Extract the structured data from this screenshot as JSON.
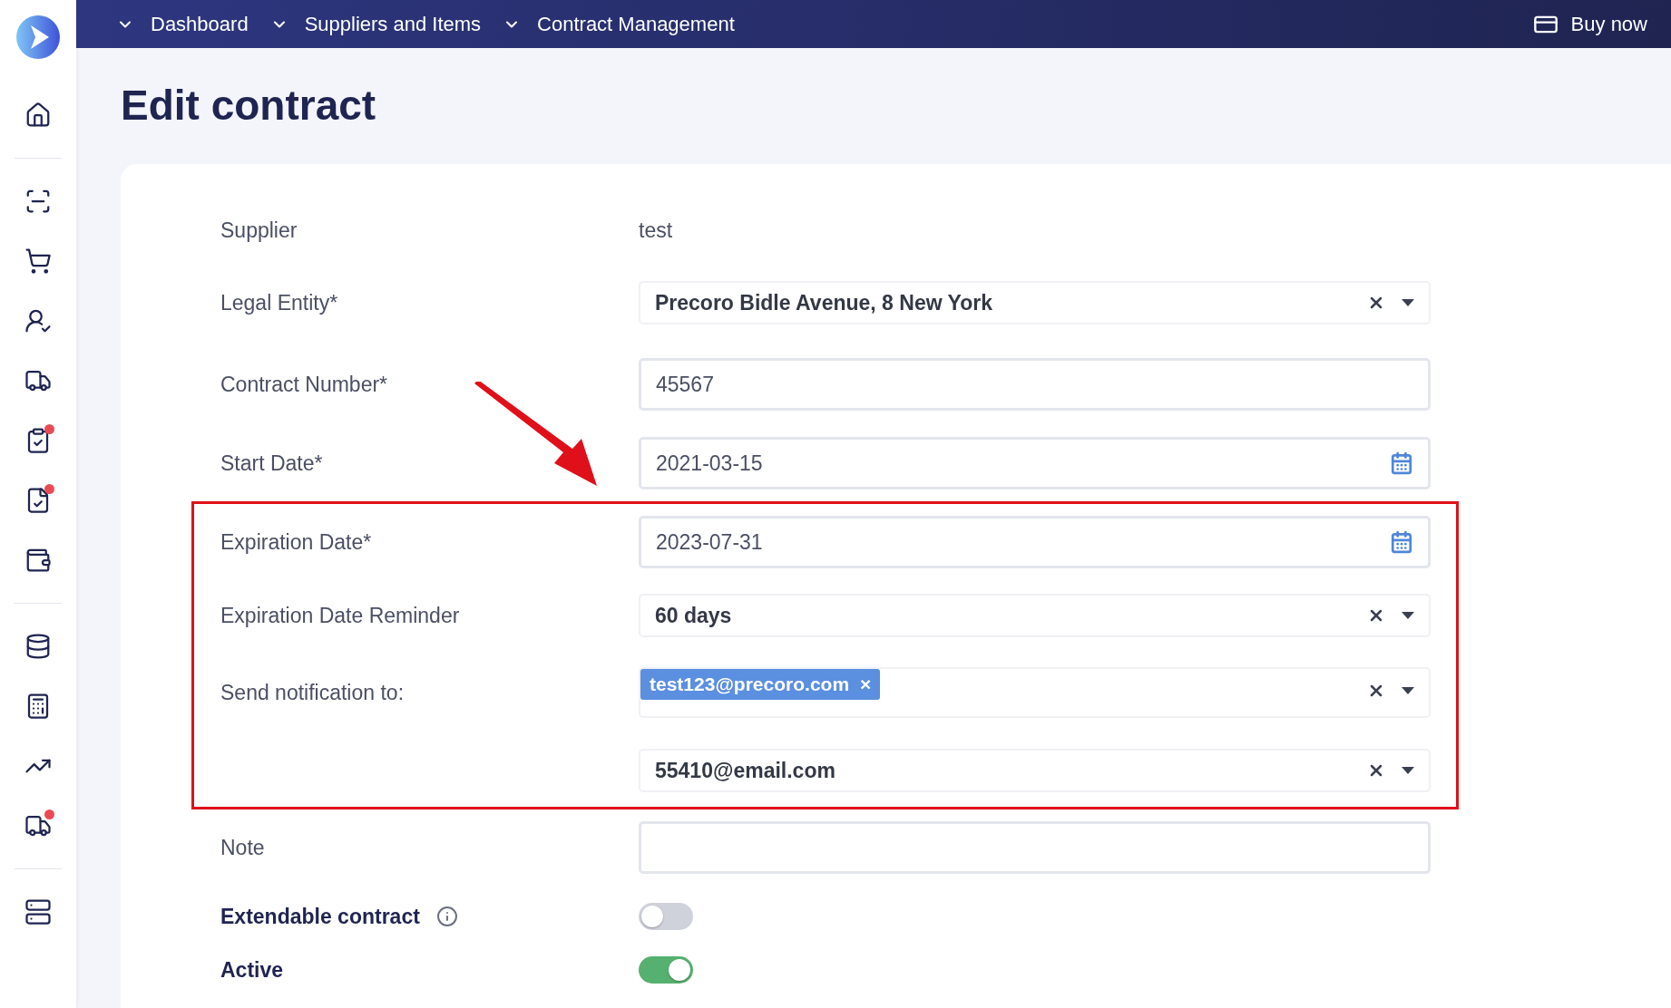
{
  "sidebar": {
    "items": [
      {
        "badge": false
      },
      {
        "badge": false
      },
      {
        "badge": false
      },
      {
        "badge": false
      },
      {
        "badge": false
      },
      {
        "badge": true
      },
      {
        "badge": true
      },
      {
        "badge": false
      },
      {
        "badge": false
      },
      {
        "badge": false
      },
      {
        "badge": false
      },
      {
        "badge": true
      },
      {
        "badge": false
      }
    ]
  },
  "topbar": {
    "menus": [
      {
        "label": "Dashboard"
      },
      {
        "label": "Suppliers and Items"
      },
      {
        "label": "Contract Management"
      }
    ],
    "buy_now": "Buy now"
  },
  "title": "Edit contract",
  "form": {
    "rows": [
      {
        "kind": "text",
        "label": "Supplier",
        "value": "test",
        "highlighted": false
      },
      {
        "kind": "select",
        "label": "Legal Entity*",
        "value": "Precoro Bidle Avenue, 8 New York",
        "highlighted": false
      },
      {
        "kind": "input",
        "label": "Contract Number*",
        "value": "45567",
        "highlighted": false
      },
      {
        "kind": "date",
        "label": "Start Date*",
        "value": "2021-03-15",
        "highlighted": false
      },
      {
        "kind": "date",
        "label": "Expiration Date*",
        "value": "2023-07-31",
        "highlighted": true
      },
      {
        "kind": "select",
        "label": "Expiration Date Reminder",
        "value": "60 days",
        "highlighted": true
      },
      {
        "kind": "tags",
        "label": "Send notification to:",
        "tags": [
          {
            "label": "test123@precoro.com",
            "remove": "×"
          }
        ],
        "highlighted": true
      },
      {
        "kind": "select",
        "value": "55410@email.com",
        "highlighted": true
      },
      {
        "kind": "input",
        "label": "Note",
        "highlighted": false
      },
      {
        "kind": "toggle",
        "label": "Extendable contract",
        "info": true,
        "on": false,
        "highlighted": false
      },
      {
        "kind": "toggle",
        "label": "Active",
        "info": false,
        "on": true,
        "highlighted": false
      }
    ]
  },
  "annotation_arrow": true
}
